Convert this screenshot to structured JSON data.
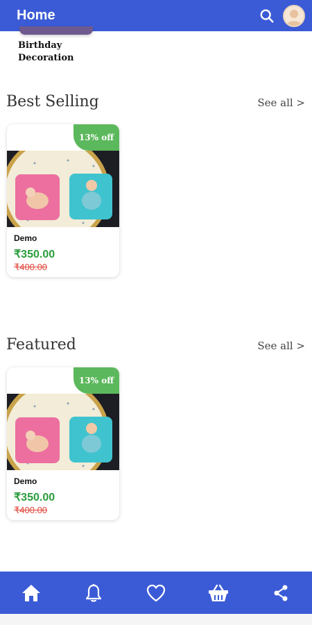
{
  "appbar": {
    "title": "Home",
    "search_icon": "search-icon",
    "avatar_icon": "avatar"
  },
  "category": {
    "label": "Birthday Decoration"
  },
  "sections": [
    {
      "title": "Best Selling",
      "see_all": "See all >",
      "product": {
        "badge": "13% off",
        "name": "Demo",
        "price": "₹350.00",
        "old_price": "₹400.00"
      }
    },
    {
      "title": "Featured",
      "see_all": "See all >",
      "product": {
        "badge": "13% off",
        "name": "Demo",
        "price": "₹350.00",
        "old_price": "₹400.00"
      }
    }
  ],
  "bottom_nav": {
    "items": [
      "home-icon",
      "bell-icon",
      "heart-icon",
      "basket-icon",
      "share-icon"
    ]
  },
  "colors": {
    "primary": "#3b5bd6",
    "badge": "#5cb85c",
    "price": "#2a9d3c",
    "old_price": "#e0463a"
  }
}
